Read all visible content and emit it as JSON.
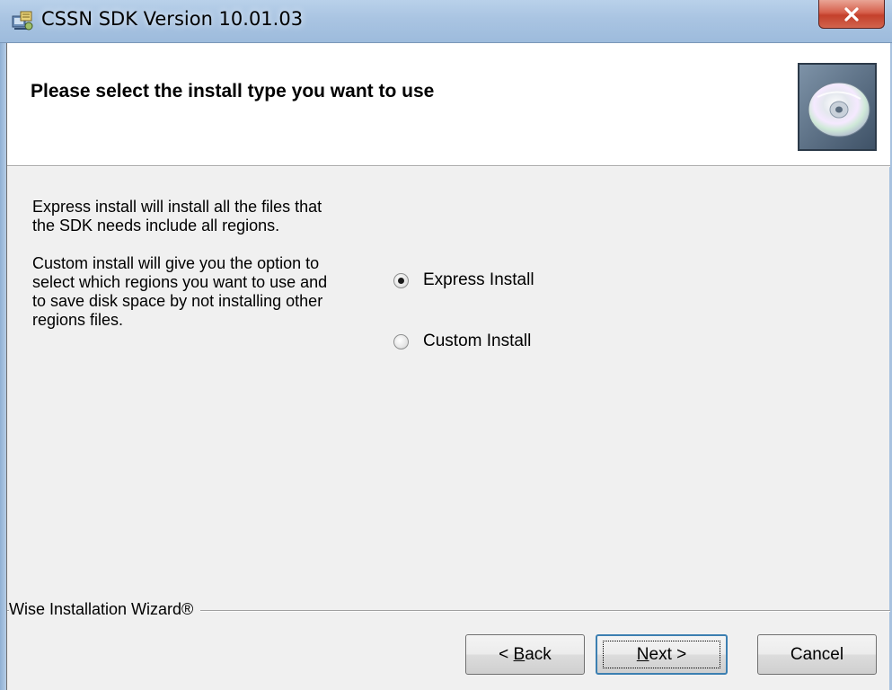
{
  "window": {
    "title": "CSSN SDK Version 10.01.03",
    "close_glyph": "X"
  },
  "header": {
    "title": "Please select the install type you want to use",
    "icon": "cd-disc-icon"
  },
  "description": {
    "express": "Express install will install all the files that the SDK needs include all regions.",
    "custom": "Custom install will give you the option to select which regions you want to use and to save disk space by not installing other regions files."
  },
  "install_type": {
    "selected": "express",
    "options": [
      {
        "id": "express",
        "label": "Express Install",
        "checked": true
      },
      {
        "id": "custom",
        "label": "Custom Install",
        "checked": false
      }
    ]
  },
  "branding": {
    "label": "Wise Installation Wizard®"
  },
  "buttons": {
    "back": {
      "prefix": "< ",
      "mnemonic": "B",
      "rest": "ack"
    },
    "next": {
      "mnemonic": "N",
      "rest": "ext >"
    },
    "cancel": {
      "label": "Cancel"
    }
  },
  "colors": {
    "dialog_bg": "#f0f0f0",
    "header_bg": "#ffffff",
    "titlebar": "#a9c4e2",
    "close_button": "#c4402b",
    "default_button_border": "#3c7fb1"
  }
}
